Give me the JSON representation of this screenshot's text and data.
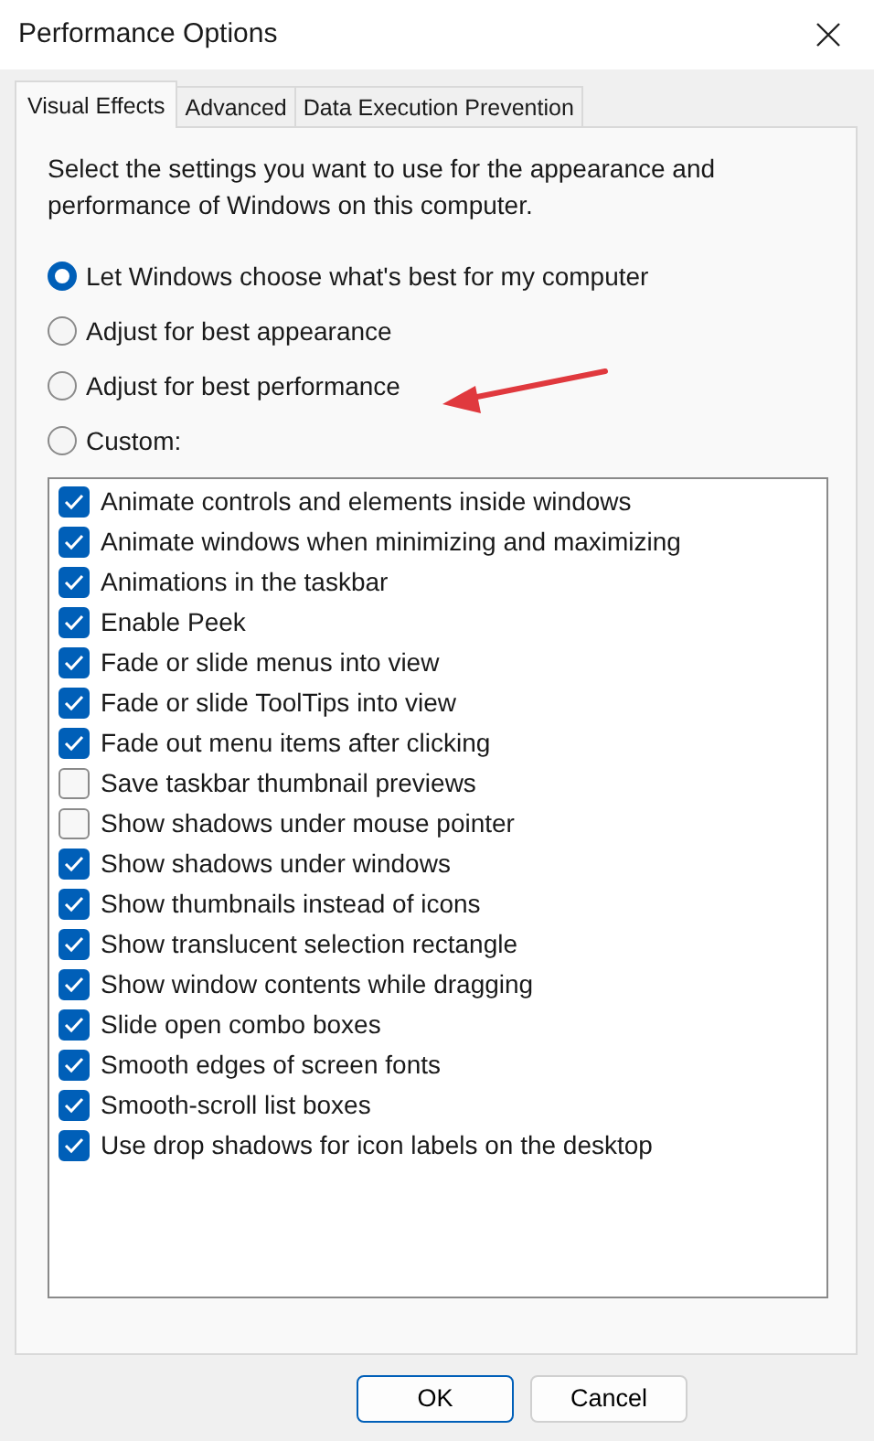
{
  "window": {
    "title": "Performance Options"
  },
  "tabs": [
    {
      "label": "Visual Effects",
      "selected": true
    },
    {
      "label": "Advanced",
      "selected": false
    },
    {
      "label": "Data Execution Prevention",
      "selected": false
    }
  ],
  "description": "Select the settings you want to use for the appearance and performance of Windows on this computer.",
  "options": [
    {
      "label": "Let Windows choose what's best for my computer",
      "selected": true
    },
    {
      "label": "Adjust for best appearance",
      "selected": false
    },
    {
      "label": "Adjust for best performance",
      "selected": false
    },
    {
      "label": "Custom:",
      "selected": false
    }
  ],
  "effects": [
    {
      "label": "Animate controls and elements inside windows",
      "checked": true
    },
    {
      "label": "Animate windows when minimizing and maximizing",
      "checked": true
    },
    {
      "label": "Animations in the taskbar",
      "checked": true
    },
    {
      "label": "Enable Peek",
      "checked": true
    },
    {
      "label": "Fade or slide menus into view",
      "checked": true
    },
    {
      "label": "Fade or slide ToolTips into view",
      "checked": true
    },
    {
      "label": "Fade out menu items after clicking",
      "checked": true
    },
    {
      "label": "Save taskbar thumbnail previews",
      "checked": false
    },
    {
      "label": "Show shadows under mouse pointer",
      "checked": false
    },
    {
      "label": "Show shadows under windows",
      "checked": true
    },
    {
      "label": "Show thumbnails instead of icons",
      "checked": true
    },
    {
      "label": "Show translucent selection rectangle",
      "checked": true
    },
    {
      "label": "Show window contents while dragging",
      "checked": true
    },
    {
      "label": "Slide open combo boxes",
      "checked": true
    },
    {
      "label": "Smooth edges of screen fonts",
      "checked": true
    },
    {
      "label": "Smooth-scroll list boxes",
      "checked": true
    },
    {
      "label": "Use drop shadows for icon labels on the desktop",
      "checked": true
    }
  ],
  "buttons": [
    {
      "label": "OK",
      "default": true
    },
    {
      "label": "Cancel",
      "default": false
    }
  ]
}
